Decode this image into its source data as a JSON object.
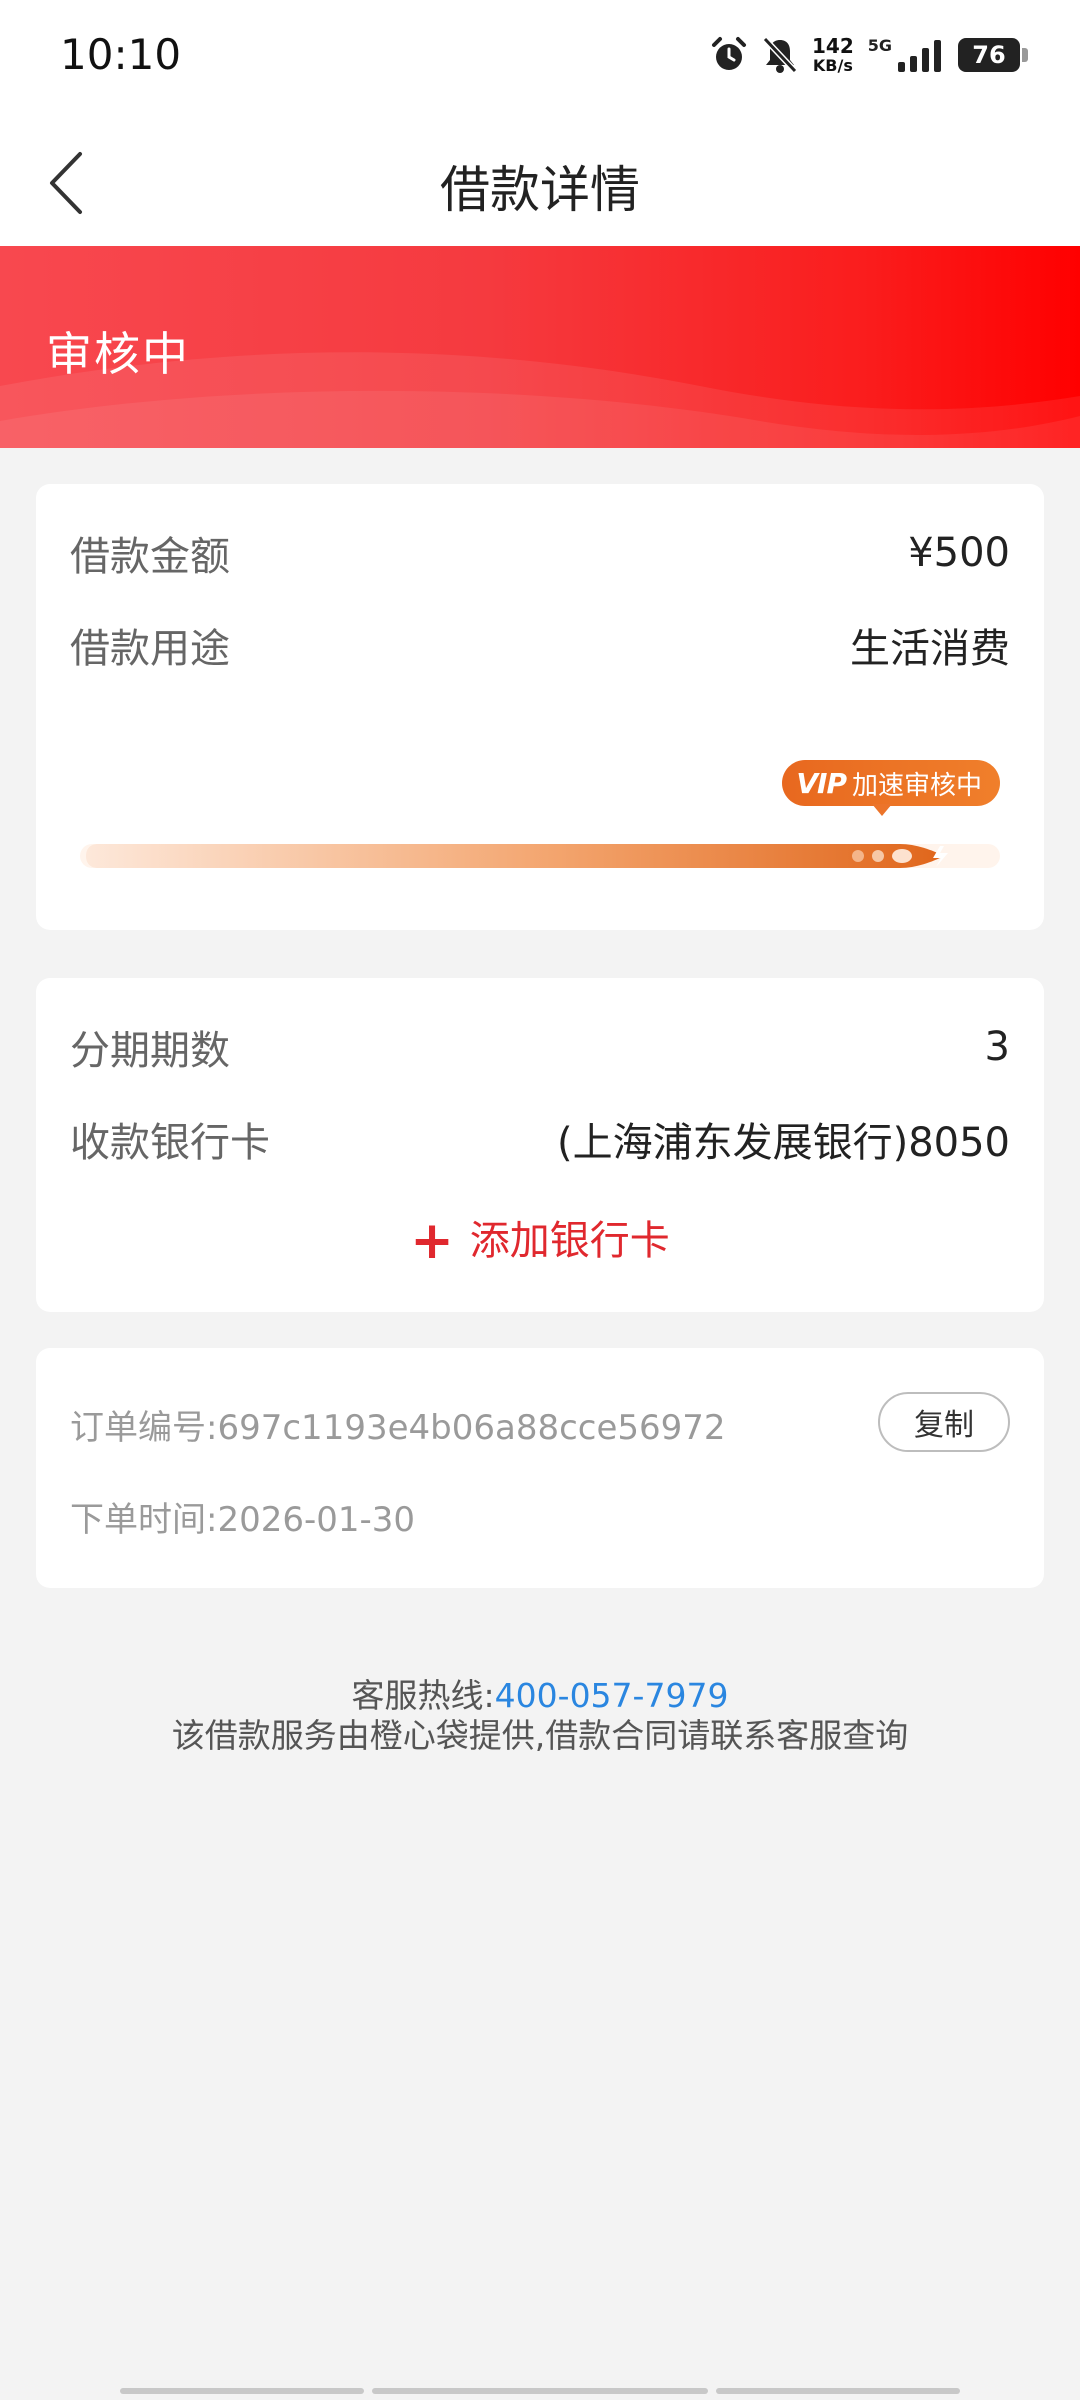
{
  "status_bar": {
    "time": "10:10",
    "net_speed_value": "142",
    "net_speed_unit": "KB/s",
    "network": "5G",
    "battery": "76",
    "icons": [
      "alarm-icon",
      "bell-off-icon",
      "signal-icon",
      "battery-icon"
    ]
  },
  "nav": {
    "title": "借款详情",
    "back_icon": "chevron-left-icon"
  },
  "banner": {
    "status": "审核中",
    "color": "#f53a3f"
  },
  "loan": {
    "amount_label": "借款金额",
    "amount_value": "¥500",
    "purpose_label": "借款用途",
    "purpose_value": "生活消费",
    "vip_tag": "VIP",
    "vip_text": "加速审核中",
    "accent": "#e8681f"
  },
  "repayment": {
    "installments_label": "分期期数",
    "installments_value": "3",
    "bank_label": "收款银行卡",
    "bank_value": "(上海浦东发展银行)8050",
    "add_bank_label": "添加银行卡",
    "add_icon": "plus-icon"
  },
  "order": {
    "id_label": "订单编号:",
    "id_value": "697c1193e4b06a88cce56972",
    "copy_label": "复制",
    "time_label": "下单时间:",
    "time_value": "2026-01-30"
  },
  "footer": {
    "hotline_label": "客服热线:",
    "hotline_number": "400-057-7979",
    "notice": "该借款服务由橙心袋提供,借款合同请联系客服查询",
    "link_color": "#2a86e0"
  }
}
